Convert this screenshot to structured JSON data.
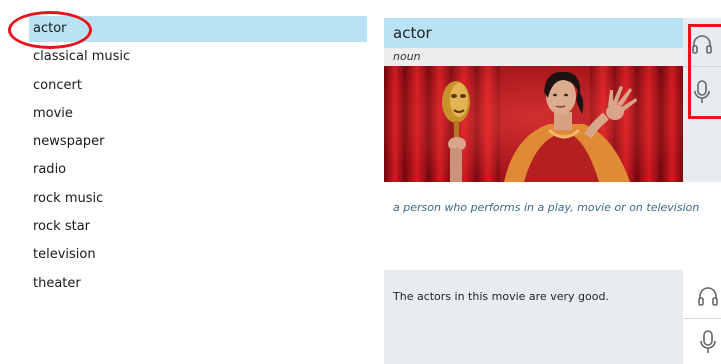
{
  "word_list": {
    "items": [
      {
        "label": "actor",
        "selected": true
      },
      {
        "label": "classical music"
      },
      {
        "label": "concert"
      },
      {
        "label": "movie"
      },
      {
        "label": "newspaper"
      },
      {
        "label": "radio"
      },
      {
        "label": "rock music"
      },
      {
        "label": "rock star"
      },
      {
        "label": "television"
      },
      {
        "label": "theater"
      }
    ]
  },
  "card": {
    "word": "actor",
    "part_of_speech": "noun",
    "definition": "a person who performs in a play, movie or on television",
    "picture_icon": "actor-photo",
    "actions": [
      "headphones-icon",
      "microphone-icon"
    ]
  },
  "example": {
    "sentence": "The actors in this movie are very good.",
    "actions": [
      "headphones-icon",
      "microphone-icon"
    ]
  },
  "colors": {
    "selected_bg": "#b9e3f5",
    "annotation_red": "#e8141b",
    "definition_text": "#3b6a8a",
    "panel_gray": "#e9ecef"
  }
}
